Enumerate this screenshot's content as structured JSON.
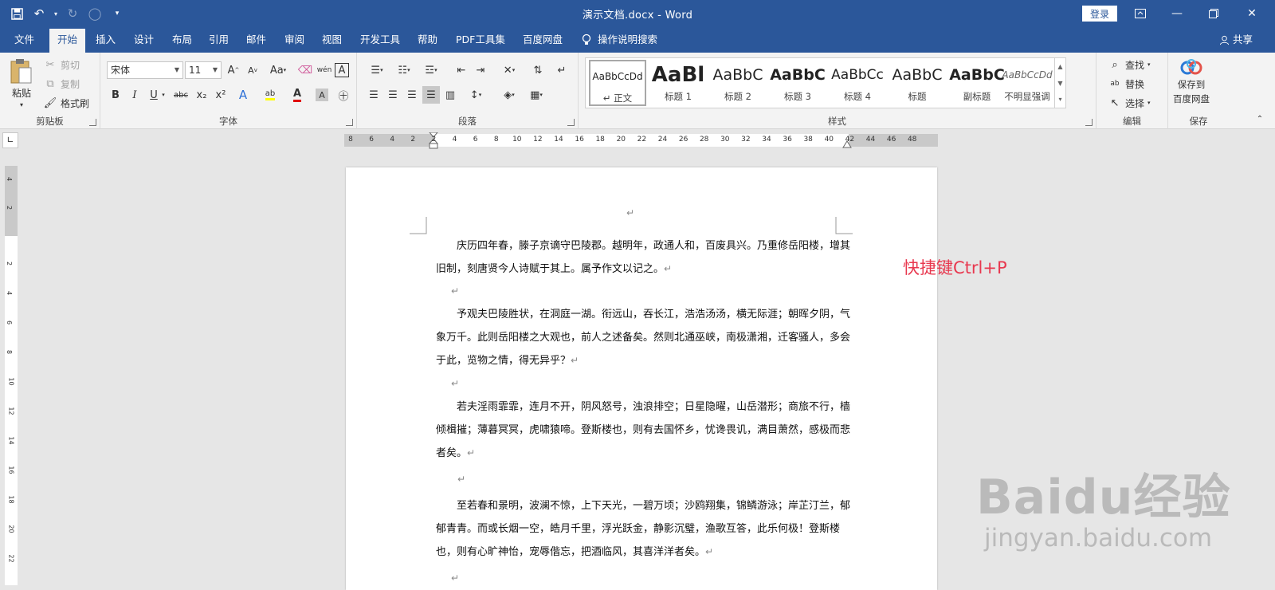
{
  "titlebar": {
    "doc_name": "演示文档.docx",
    "separator": " - ",
    "app_name": "Word",
    "login": "登录"
  },
  "menu": {
    "tabs": [
      "文件",
      "开始",
      "插入",
      "设计",
      "布局",
      "引用",
      "邮件",
      "审阅",
      "视图",
      "开发工具",
      "帮助",
      "PDF工具集",
      "百度网盘"
    ],
    "active": "开始",
    "search": "操作说明搜索",
    "share": "共享"
  },
  "ribbon": {
    "clipboard": {
      "label": "剪贴板",
      "paste": "粘贴",
      "cut": "剪切",
      "copy": "复制",
      "format_painter": "格式刷"
    },
    "font": {
      "label": "字体",
      "name": "宋体",
      "size": "11",
      "aa": "Aa",
      "bold": "B",
      "italic": "I",
      "underline": "U",
      "strike": "abc",
      "sub": "x₂",
      "sup": "x²",
      "color_a": "A"
    },
    "paragraph": {
      "label": "段落"
    },
    "styles": {
      "label": "样式",
      "items": [
        {
          "sample": "AaBbCcDd",
          "name": "↵ 正文"
        },
        {
          "sample": "AaBl",
          "name": "标题 1"
        },
        {
          "sample": "AaBbC",
          "name": "标题 2"
        },
        {
          "sample": "AaBbC",
          "name": "标题 3"
        },
        {
          "sample": "AaBbCc",
          "name": "标题 4"
        },
        {
          "sample": "AaBbC",
          "name": "标题"
        },
        {
          "sample": "AaBbC",
          "name": "副标题"
        },
        {
          "sample": "AaBbCcDd",
          "name": "不明显强调"
        }
      ]
    },
    "editing": {
      "label": "编辑",
      "find": "查找",
      "replace": "替换",
      "select": "选择"
    },
    "save": {
      "label": "保存",
      "line1": "保存到",
      "line2": "百度网盘"
    }
  },
  "ruler": {
    "h_ticks": [
      "8",
      "6",
      "4",
      "2",
      "2",
      "4",
      "6",
      "8",
      "10",
      "12",
      "14",
      "16",
      "18",
      "20",
      "22",
      "24",
      "26",
      "28",
      "30",
      "32",
      "34",
      "36",
      "38",
      "40",
      "42",
      "44",
      "46",
      "48"
    ],
    "v_ticks": [
      "4",
      "2",
      "2",
      "4",
      "6",
      "8",
      "10",
      "12",
      "14",
      "16",
      "18",
      "20",
      "22"
    ]
  },
  "document": {
    "paragraphs": [
      "庆历四年春，滕子京谪守巴陵郡。越明年，政通人和，百废具兴。乃重修岳阳楼，增其旧制，刻唐贤今人诗赋于其上。属予作文以记之。",
      "予观夫巴陵胜状，在洞庭一湖。衔远山，吞长江，浩浩汤汤，横无际涯；朝晖夕阴，气象万千。此则岳阳楼之大观也，前人之述备矣。然则北通巫峡，南极潇湘，迁客骚人，多会于此，览物之情，得无异乎？",
      "若夫淫雨霏霏，连月不开，阴风怒号，浊浪排空；日星隐曜，山岳潜形；商旅不行，樯倾楫摧；薄暮冥冥，虎啸猿啼。登斯楼也，则有去国怀乡，忧谗畏讥，满目萧然，感极而悲者矣。",
      "至若春和景明，波澜不惊，上下天光，一碧万顷；沙鸥翔集，锦鳞游泳；岸芷汀兰，郁郁青青。而或长烟一空，皓月千里，浮光跃金，静影沉璧，渔歌互答，此乐何极！登斯楼也，则有心旷神怡，宠辱偕忘，把酒临风，其喜洋洋者矣。"
    ],
    "para_mark": "↵"
  },
  "annotation": "快捷键Ctrl+P",
  "watermark": {
    "logo": "Baidu经验",
    "url": "jingyan.baidu.com"
  }
}
